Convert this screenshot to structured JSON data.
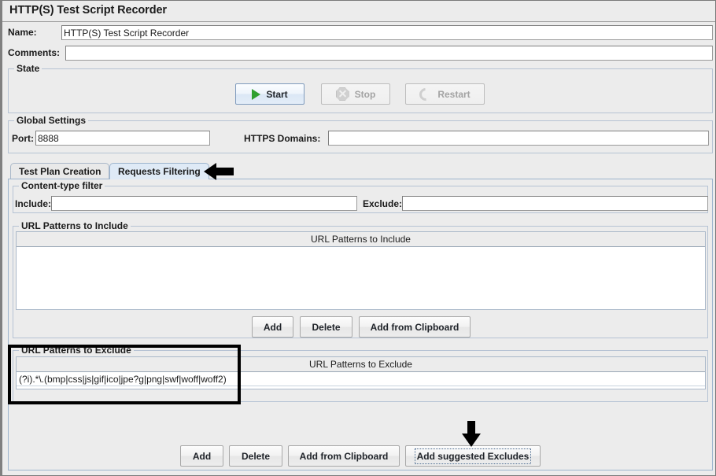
{
  "window": {
    "title": "HTTP(S) Test Script Recorder"
  },
  "fields": {
    "name_label": "Name:",
    "name_value": "HTTP(S) Test Script Recorder",
    "comments_label": "Comments:",
    "comments_value": ""
  },
  "state": {
    "group_title": "State",
    "start_label": "Start",
    "stop_label": "Stop",
    "restart_label": "Restart",
    "start_icon": "play-icon",
    "stop_icon": "stop-octagon-icon",
    "restart_icon": "restart-circular-arrow-icon"
  },
  "global_settings": {
    "group_title": "Global Settings",
    "port_label": "Port:",
    "port_value": "8888",
    "https_domains_label": "HTTPS Domains:",
    "https_domains_value": ""
  },
  "tabs": {
    "items": [
      {
        "label": "Test Plan Creation",
        "active": false
      },
      {
        "label": "Requests Filtering",
        "active": true
      }
    ]
  },
  "content_type_filter": {
    "group_title": "Content-type filter",
    "include_label": "Include:",
    "include_value": "",
    "exclude_label": "Exclude:",
    "exclude_value": ""
  },
  "url_include": {
    "group_title": "URL Patterns to Include",
    "column_header": "URL Patterns to Include",
    "rows": [],
    "buttons": [
      "Add",
      "Delete",
      "Add from Clipboard"
    ]
  },
  "url_exclude": {
    "group_title": "URL Patterns to Exclude",
    "column_header": "URL Patterns to Exclude",
    "rows": [
      "(?i).*\\.(bmp|css|js|gif|ico|jpe?g|png|swf|woff|woff2)"
    ],
    "buttons": [
      "Add",
      "Delete",
      "Add from Clipboard",
      "Add suggested Excludes"
    ],
    "focused_button": "Add suggested Excludes"
  },
  "annotations": {
    "highlight_target": "url-patterns-to-exclude-group",
    "arrow_tab_target": "Requests Filtering",
    "arrow_button_target": "Add suggested Excludes",
    "color": "#000000"
  }
}
